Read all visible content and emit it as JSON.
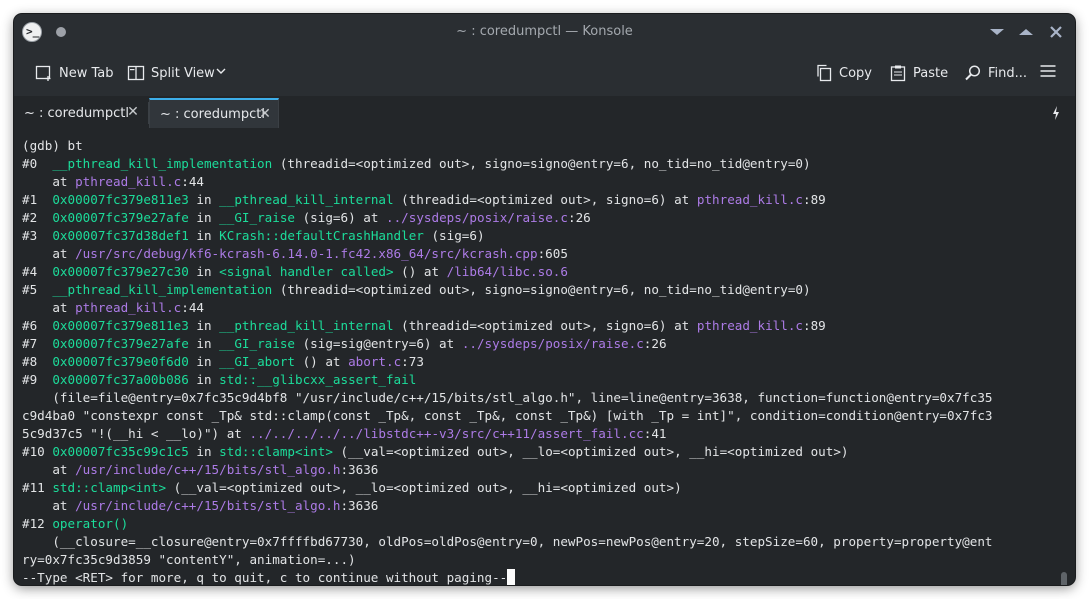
{
  "window": {
    "title": "~ : coredumpctl — Konsole",
    "app_icon_glyph": ">_"
  },
  "toolbar": {
    "new_tab": "New Tab",
    "split_view": "Split View",
    "copy": "Copy",
    "paste": "Paste",
    "find": "Find..."
  },
  "tabs": [
    {
      "label": "~ : coredumpctl",
      "active": false
    },
    {
      "label": "~ : coredumpctl",
      "active": true
    }
  ],
  "colors": {
    "accent": "#3daee9",
    "function_name": "#1cdc9a",
    "file_path": "#ac7be6",
    "text": "#e2e4e6",
    "background": "#232629"
  },
  "icons": {
    "app": "terminal-icon",
    "pin": "pin-icon",
    "minimize": "minimize-icon",
    "maximize": "maximize-icon",
    "close": "close-icon",
    "new_tab": "new-tab-icon",
    "split_view": "split-view-icon",
    "split_menu": "chevron-down-icon",
    "copy": "copy-icon",
    "paste": "paste-icon",
    "find": "search-icon",
    "menu": "hamburger-menu-icon",
    "tab_close": "close-icon",
    "tab_menu": "tab-menu-icon"
  },
  "terminal": {
    "lines": [
      [
        [
          "(gdb) bt",
          ""
        ]
      ],
      [
        [
          "#0  ",
          ""
        ],
        [
          "__pthread_kill_implementation",
          "g"
        ],
        [
          " (threadid=<optimized out>, signo=signo@entry=6, no_tid=no_tid@entry=0)",
          ""
        ]
      ],
      [
        [
          "    at ",
          ""
        ],
        [
          "pthread_kill.c",
          "p"
        ],
        [
          ":44",
          ""
        ]
      ],
      [
        [
          "#1  ",
          ""
        ],
        [
          "0x00007fc379e811e3",
          "g"
        ],
        [
          " in ",
          ""
        ],
        [
          "__pthread_kill_internal",
          "g"
        ],
        [
          " (threadid=<optimized out>, signo=6) at ",
          ""
        ],
        [
          "pthread_kill.c",
          "p"
        ],
        [
          ":89",
          ""
        ]
      ],
      [
        [
          "#2  ",
          ""
        ],
        [
          "0x00007fc379e27afe",
          "g"
        ],
        [
          " in ",
          ""
        ],
        [
          "__GI_raise",
          "g"
        ],
        [
          " (sig=6) at ",
          ""
        ],
        [
          "../sysdeps/posix/raise.c",
          "p"
        ],
        [
          ":26",
          ""
        ]
      ],
      [
        [
          "#3  ",
          ""
        ],
        [
          "0x00007fc37d38def1",
          "g"
        ],
        [
          " in ",
          ""
        ],
        [
          "KCrash::defaultCrashHandler",
          "g"
        ],
        [
          " (sig=6)",
          ""
        ]
      ],
      [
        [
          "    at ",
          ""
        ],
        [
          "/usr/src/debug/kf6-kcrash-6.14.0-1.fc42.x86_64/src/kcrash.cpp",
          "p"
        ],
        [
          ":605",
          ""
        ]
      ],
      [
        [
          "#4  ",
          ""
        ],
        [
          "0x00007fc379e27c30",
          "g"
        ],
        [
          " in ",
          ""
        ],
        [
          "<signal handler called>",
          "g"
        ],
        [
          " () at ",
          ""
        ],
        [
          "/lib64/libc.so.6",
          "p"
        ]
      ],
      [
        [
          "#5  ",
          ""
        ],
        [
          "__pthread_kill_implementation",
          "g"
        ],
        [
          " (threadid=<optimized out>, signo=signo@entry=6, no_tid=no_tid@entry=0)",
          ""
        ]
      ],
      [
        [
          "    at ",
          ""
        ],
        [
          "pthread_kill.c",
          "p"
        ],
        [
          ":44",
          ""
        ]
      ],
      [
        [
          "#6  ",
          ""
        ],
        [
          "0x00007fc379e811e3",
          "g"
        ],
        [
          " in ",
          ""
        ],
        [
          "__pthread_kill_internal",
          "g"
        ],
        [
          " (threadid=<optimized out>, signo=6) at ",
          ""
        ],
        [
          "pthread_kill.c",
          "p"
        ],
        [
          ":89",
          ""
        ]
      ],
      [
        [
          "#7  ",
          ""
        ],
        [
          "0x00007fc379e27afe",
          "g"
        ],
        [
          " in ",
          ""
        ],
        [
          "__GI_raise",
          "g"
        ],
        [
          " (sig=sig@entry=6) at ",
          ""
        ],
        [
          "../sysdeps/posix/raise.c",
          "p"
        ],
        [
          ":26",
          ""
        ]
      ],
      [
        [
          "#8  ",
          ""
        ],
        [
          "0x00007fc379e0f6d0",
          "g"
        ],
        [
          " in ",
          ""
        ],
        [
          "__GI_abort",
          "g"
        ],
        [
          " () at ",
          ""
        ],
        [
          "abort.c",
          "p"
        ],
        [
          ":73",
          ""
        ]
      ],
      [
        [
          "#9  ",
          ""
        ],
        [
          "0x00007fc37a00b086",
          "g"
        ],
        [
          " in ",
          ""
        ],
        [
          "std::__glibcxx_assert_fail",
          "g"
        ]
      ],
      [
        [
          "    (file=file@entry=0x7fc35c9d4bf8 \"/usr/include/c++/15/bits/stl_algo.h\", line=line@entry=3638, function=function@entry=0x7fc35",
          ""
        ]
      ],
      [
        [
          "c9d4ba0 \"constexpr const _Tp& std::clamp(const _Tp&, const _Tp&, const _Tp&) [with _Tp = int]\", condition=condition@entry=0x7fc3",
          ""
        ]
      ],
      [
        [
          "5c9d37c5 \"!(__hi < __lo)\") at ",
          ""
        ],
        [
          "../../../../../libstdc++-v3/src/c++11/assert_fail.cc",
          "p"
        ],
        [
          ":41",
          ""
        ]
      ],
      [
        [
          "#10 ",
          ""
        ],
        [
          "0x00007fc35c99c1c5",
          "g"
        ],
        [
          " in ",
          ""
        ],
        [
          "std::clamp<int>",
          "g"
        ],
        [
          " (__val=<optimized out>, __lo=<optimized out>, __hi=<optimized out>)",
          ""
        ]
      ],
      [
        [
          "    at ",
          ""
        ],
        [
          "/usr/include/c++/15/bits/stl_algo.h",
          "p"
        ],
        [
          ":3636",
          ""
        ]
      ],
      [
        [
          "#11 ",
          ""
        ],
        [
          "std::clamp<int>",
          "g"
        ],
        [
          " (__val=<optimized out>, __lo=<optimized out>, __hi=<optimized out>)",
          ""
        ]
      ],
      [
        [
          "    at ",
          ""
        ],
        [
          "/usr/include/c++/15/bits/stl_algo.h",
          "p"
        ],
        [
          ":3636",
          ""
        ]
      ],
      [
        [
          "#12 ",
          ""
        ],
        [
          "operator()",
          "g"
        ]
      ],
      [
        [
          "    (__closure=__closure@entry=0x7ffffbd67730, oldPos=oldPos@entry=0, newPos=newPos@entry=20, stepSize=60, property=property@ent",
          ""
        ]
      ],
      [
        [
          "ry=0x7fc35c9d3859 \"contentY\", animation=...)",
          ""
        ]
      ]
    ],
    "prompt_line": "--Type <RET> for more, q to quit, c to continue without paging--"
  }
}
